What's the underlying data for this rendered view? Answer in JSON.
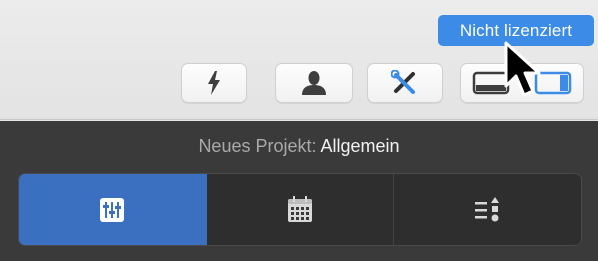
{
  "license_badge": {
    "text": "Nicht lizenziert"
  },
  "toolbar": {
    "buttons": [
      {
        "icon": "lightning-icon"
      },
      {
        "icon": "person-icon"
      },
      {
        "icon": "tools-icon"
      },
      {
        "icon": "layout-toggle-icon"
      }
    ]
  },
  "header": {
    "label": "Neues Projekt:",
    "value": "Allgemein"
  },
  "segmented": {
    "items": [
      {
        "icon": "sliders-icon",
        "selected": true
      },
      {
        "icon": "calendar-icon",
        "selected": false
      },
      {
        "icon": "list-order-icon",
        "selected": false
      }
    ]
  },
  "colors": {
    "accent": "#3b8be7",
    "selected": "#3b6fc0",
    "panel": "#3a3a3a"
  }
}
